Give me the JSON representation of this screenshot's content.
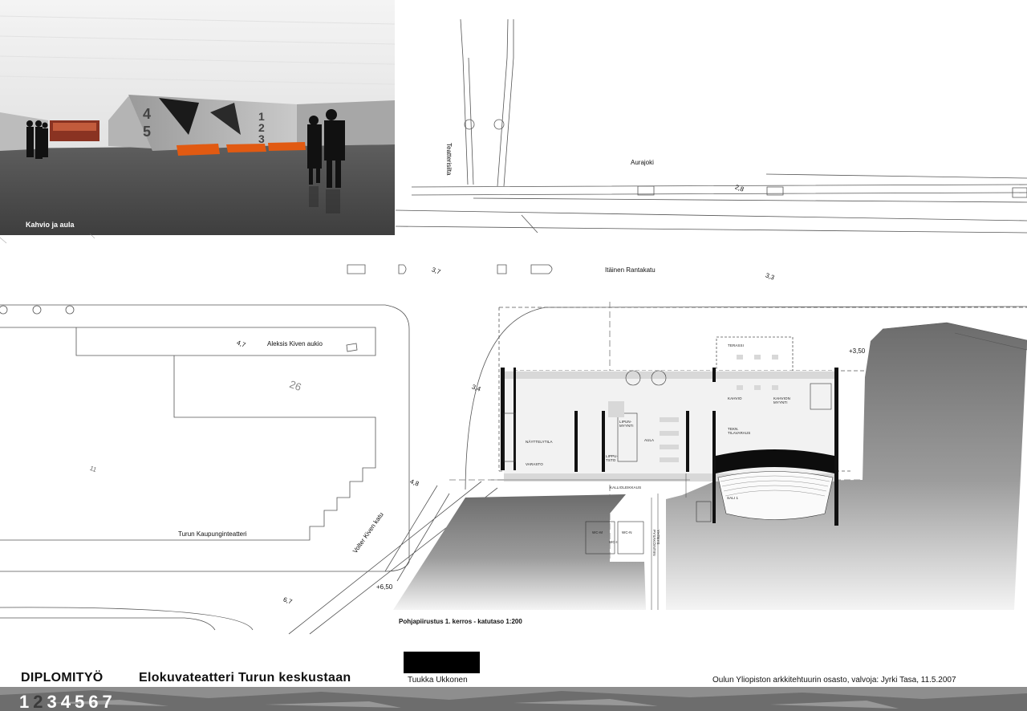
{
  "render": {
    "caption": "Kahvio ja aula",
    "signage_left": "4 5",
    "signage_right": "1 2 3"
  },
  "map_labels": {
    "river": "Aurajoki",
    "bridge": "Teatterisilta",
    "street_main": "Itäinen Rantakatu",
    "square": "Aleksis Kiven aukio",
    "street_side": "Volter Kiven katu",
    "theatre": "Turun Kaupunginteatteri",
    "elev_28": "2,8",
    "elev_37": "3,7",
    "elev_33": "3,3",
    "elev_47": "4,7",
    "elev_26": "26",
    "elev_34": "3,4",
    "elev_48": "4,8",
    "elev_11": "11",
    "elev_67": "6,7",
    "level_350": "+3,50",
    "level_650": "+6,50"
  },
  "room_labels": {
    "terrace": "TERASSI",
    "cafe": "KAHVIO",
    "cafe_sales": "KAHVION MYYNTI",
    "ticket_sales": "LIPUN- MYYNTI",
    "exhibition": "NÄYTTELYTILA",
    "storage": "VARASTO",
    "ticket_office": "LIPPU- TSTO",
    "lobby": "AULA",
    "tech_storage": "TEKN. TILAVARAUS",
    "rock_passage": "KALLIOLEIKKAUS",
    "hall": "SALI 1",
    "wc_women": "WC-M",
    "wc_men": "WC-N",
    "wc_inv": "WC-I",
    "service_corridor": "YHTEYS PYSÄKÖINTIIN"
  },
  "plan_title": "Pohjapiirustus 1. kerros - katutaso 1:200",
  "footer": {
    "label": "DIPLOMITYÖ",
    "title": "Elokuvateatteri Turun keskustaan",
    "author": "Tuukka Ukkonen",
    "credit": "Oulun Yliopiston arkkitehtuurin osasto, valvoja: Jyrki Tasa, 11.5.2007"
  },
  "pages": [
    "1",
    "2",
    "3",
    "4",
    "5",
    "6",
    "7"
  ],
  "current_page": "2"
}
